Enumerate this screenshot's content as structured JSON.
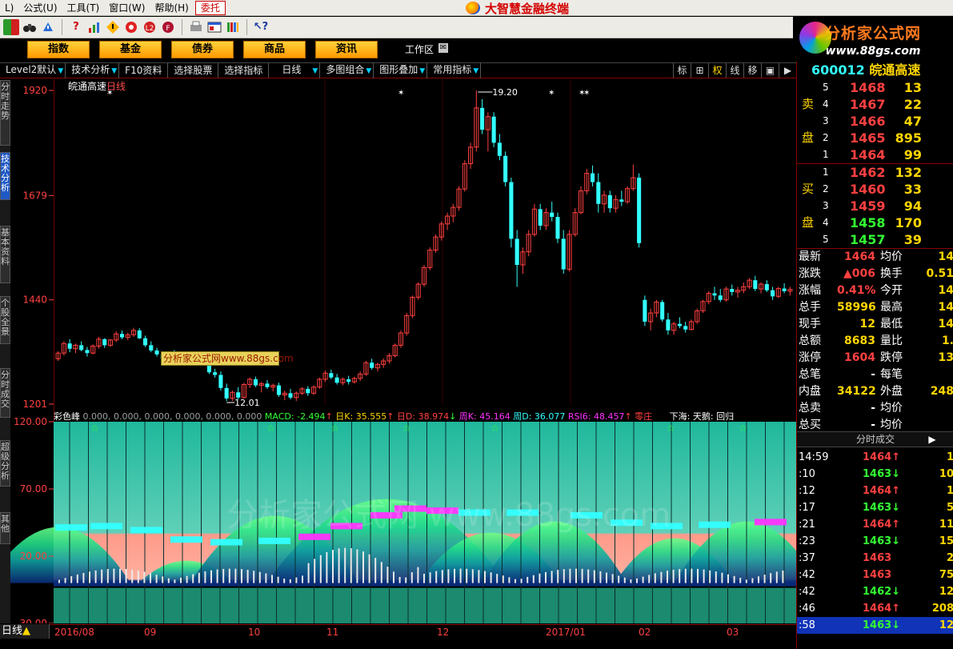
{
  "menu": {
    "items": [
      "L)",
      "公式(U)",
      "工具(T)",
      "窗口(W)",
      "帮助(H)"
    ],
    "hot_button": "委托",
    "app_title": "大智慧金融终端"
  },
  "brand": {
    "name": "分析家公式网",
    "url": "www.88gs.com"
  },
  "nav": {
    "buttons": [
      "指数",
      "基金",
      "债券",
      "商品",
      "资讯"
    ],
    "workspace": "工作区"
  },
  "side_tabs": [
    "分时走势",
    "技术分析",
    "基本资料",
    "个股全景",
    "分时成交",
    "超级分析",
    "其他"
  ],
  "tabs": {
    "items": [
      "Level2默认",
      "技术分析",
      "F10资料",
      "选择股票",
      "选择指标",
      "日线",
      "多图组合",
      "图形叠加",
      "常用指标"
    ],
    "right_buttons": [
      "标",
      "⊞",
      "权",
      "线",
      "移",
      "▣",
      "▶"
    ]
  },
  "chart": {
    "stock_name": "皖通高速",
    "period_label": "日线",
    "price_ticks": [
      "1920",
      "1679",
      "1440",
      "1201"
    ],
    "peak_label": "19.20",
    "trough_label": "12.01",
    "watermark_tag": "分析家公式网www.88gs.com",
    "watermark_big": "分析家公式网 www.88gs.com",
    "osc_ticks": [
      "120.00",
      "70.00",
      "20.00",
      "-30.00"
    ],
    "indicator_name": "彩色峰",
    "indicator_values": "0.000, 0.000, 0.000, 0.000, 0.000, 0.000",
    "macd": "MACD: -2.494",
    "dayk": "日K: 35.555",
    "dayd": "日D: 38.974",
    "weekk": "周K: 45.164",
    "weekd": "周D: 36.077",
    "rsi": "RSI6: 48.457",
    "extra1": "零庄",
    "extra2": "下海: 天鹅:",
    "extra3": "回归",
    "candles": [
      [
        1305,
        1322,
        1300,
        1318
      ],
      [
        1318,
        1345,
        1312,
        1340
      ],
      [
        1340,
        1350,
        1320,
        1328
      ],
      [
        1328,
        1340,
        1318,
        1336
      ],
      [
        1336,
        1345,
        1322,
        1325
      ],
      [
        1325,
        1332,
        1310,
        1318
      ],
      [
        1318,
        1338,
        1315,
        1334
      ],
      [
        1334,
        1355,
        1328,
        1350
      ],
      [
        1350,
        1352,
        1330,
        1336
      ],
      [
        1336,
        1350,
        1332,
        1348
      ],
      [
        1348,
        1368,
        1343,
        1362
      ],
      [
        1362,
        1370,
        1350,
        1354
      ],
      [
        1354,
        1365,
        1348,
        1360
      ],
      [
        1360,
        1376,
        1355,
        1370
      ],
      [
        1370,
        1375,
        1350,
        1352
      ],
      [
        1352,
        1358,
        1332,
        1336
      ],
      [
        1336,
        1345,
        1320,
        1324
      ],
      [
        1324,
        1330,
        1310,
        1315
      ],
      [
        1315,
        1322,
        1302,
        1305
      ],
      [
        1305,
        1320,
        1300,
        1316
      ],
      [
        1316,
        1325,
        1305,
        1308
      ],
      [
        1308,
        1318,
        1300,
        1312
      ],
      [
        1312,
        1318,
        1295,
        1298
      ],
      [
        1298,
        1315,
        1292,
        1310
      ],
      [
        1310,
        1322,
        1302,
        1306
      ],
      [
        1306,
        1310,
        1290,
        1294
      ],
      [
        1294,
        1298,
        1270,
        1274
      ],
      [
        1274,
        1282,
        1262,
        1268
      ],
      [
        1268,
        1276,
        1232,
        1238
      ],
      [
        1238,
        1248,
        1208,
        1214
      ],
      [
        1214,
        1232,
        1208,
        1228
      ],
      [
        1228,
        1240,
        1212,
        1216
      ],
      [
        1216,
        1250,
        1214,
        1246
      ],
      [
        1246,
        1262,
        1238,
        1258
      ],
      [
        1258,
        1264,
        1240,
        1244
      ],
      [
        1244,
        1252,
        1228,
        1248
      ],
      [
        1248,
        1256,
        1236,
        1240
      ],
      [
        1240,
        1248,
        1230,
        1244
      ],
      [
        1244,
        1250,
        1218,
        1222
      ],
      [
        1222,
        1232,
        1210,
        1226
      ],
      [
        1226,
        1236,
        1212,
        1216
      ],
      [
        1216,
        1230,
        1208,
        1226
      ],
      [
        1226,
        1240,
        1222,
        1236
      ],
      [
        1236,
        1242,
        1220,
        1226
      ],
      [
        1226,
        1244,
        1222,
        1240
      ],
      [
        1240,
        1262,
        1236,
        1258
      ],
      [
        1258,
        1278,
        1252,
        1272
      ],
      [
        1272,
        1280,
        1258,
        1262
      ],
      [
        1262,
        1270,
        1246,
        1250
      ],
      [
        1250,
        1262,
        1244,
        1258
      ],
      [
        1258,
        1266,
        1246,
        1252
      ],
      [
        1252,
        1264,
        1248,
        1260
      ],
      [
        1260,
        1276,
        1254,
        1270
      ],
      [
        1270,
        1300,
        1266,
        1296
      ],
      [
        1296,
        1305,
        1280,
        1284
      ],
      [
        1284,
        1296,
        1276,
        1292
      ],
      [
        1292,
        1306,
        1284,
        1300
      ],
      [
        1300,
        1318,
        1294,
        1312
      ],
      [
        1312,
        1340,
        1308,
        1336
      ],
      [
        1336,
        1370,
        1330,
        1364
      ],
      [
        1364,
        1410,
        1358,
        1404
      ],
      [
        1404,
        1450,
        1398,
        1446
      ],
      [
        1446,
        1480,
        1440,
        1476
      ],
      [
        1476,
        1520,
        1470,
        1514
      ],
      [
        1514,
        1560,
        1508,
        1554
      ],
      [
        1554,
        1590,
        1548,
        1584
      ],
      [
        1584,
        1620,
        1576,
        1614
      ],
      [
        1614,
        1640,
        1600,
        1632
      ],
      [
        1632,
        1660,
        1618,
        1652
      ],
      [
        1652,
        1700,
        1644,
        1694
      ],
      [
        1694,
        1760,
        1688,
        1752
      ],
      [
        1752,
        1800,
        1740,
        1790
      ],
      [
        1790,
        1920,
        1780,
        1880
      ],
      [
        1880,
        1900,
        1820,
        1830
      ],
      [
        1830,
        1870,
        1780,
        1860
      ],
      [
        1860,
        1870,
        1790,
        1800
      ],
      [
        1800,
        1820,
        1760,
        1770
      ],
      [
        1770,
        1780,
        1700,
        1710
      ],
      [
        1710,
        1720,
        1560,
        1580
      ],
      [
        1580,
        1600,
        1470,
        1520
      ],
      [
        1520,
        1560,
        1500,
        1550
      ],
      [
        1550,
        1600,
        1540,
        1590
      ],
      [
        1590,
        1660,
        1585,
        1648
      ],
      [
        1648,
        1660,
        1600,
        1610
      ],
      [
        1610,
        1650,
        1600,
        1640
      ],
      [
        1640,
        1665,
        1620,
        1630
      ],
      [
        1630,
        1640,
        1570,
        1580
      ],
      [
        1580,
        1600,
        1500,
        1510
      ],
      [
        1510,
        1600,
        1505,
        1590
      ],
      [
        1590,
        1650,
        1585,
        1640
      ],
      [
        1640,
        1700,
        1636,
        1690
      ],
      [
        1690,
        1740,
        1682,
        1730
      ],
      [
        1730,
        1748,
        1700,
        1710
      ],
      [
        1710,
        1730,
        1640,
        1660
      ],
      [
        1660,
        1690,
        1640,
        1680
      ],
      [
        1680,
        1690,
        1640,
        1650
      ],
      [
        1650,
        1680,
        1640,
        1670
      ],
      [
        1670,
        1690,
        1655,
        1665
      ],
      [
        1665,
        1700,
        1660,
        1695
      ],
      [
        1695,
        1750,
        1690,
        1720
      ],
      [
        1720,
        1730,
        1560,
        1570
      ],
      [
        1440,
        1450,
        1380,
        1390
      ],
      [
        1390,
        1420,
        1370,
        1410
      ],
      [
        1410,
        1440,
        1400,
        1435
      ],
      [
        1435,
        1440,
        1390,
        1395
      ],
      [
        1395,
        1410,
        1360,
        1370
      ],
      [
        1370,
        1390,
        1360,
        1385
      ],
      [
        1385,
        1400,
        1375,
        1380
      ],
      [
        1380,
        1390,
        1365,
        1372
      ],
      [
        1372,
        1395,
        1370,
        1390
      ],
      [
        1390,
        1420,
        1385,
        1415
      ],
      [
        1415,
        1440,
        1410,
        1436
      ],
      [
        1436,
        1460,
        1430,
        1455
      ],
      [
        1455,
        1470,
        1440,
        1450
      ],
      [
        1450,
        1465,
        1435,
        1440
      ],
      [
        1440,
        1470,
        1436,
        1465
      ],
      [
        1465,
        1475,
        1450,
        1458
      ],
      [
        1458,
        1470,
        1445,
        1462
      ],
      [
        1462,
        1480,
        1455,
        1470
      ],
      [
        1470,
        1490,
        1465,
        1485
      ],
      [
        1485,
        1495,
        1460,
        1465
      ],
      [
        1465,
        1480,
        1455,
        1476
      ],
      [
        1476,
        1485,
        1458,
        1462
      ],
      [
        1462,
        1470,
        1440,
        1448
      ],
      [
        1448,
        1470,
        1444,
        1466
      ],
      [
        1466,
        1478,
        1455,
        1460
      ],
      [
        1460,
        1470,
        1450,
        1464
      ]
    ],
    "x_dates": [
      "2016/08",
      "09",
      "10",
      "11",
      "12",
      "2017/01",
      "02",
      "03"
    ],
    "bottom_label": "日线"
  },
  "quote": {
    "code": "600012",
    "name": "皖通高速",
    "sell_label": [
      "卖",
      "盘"
    ],
    "buy_label": [
      "买",
      "盘"
    ],
    "asks": [
      {
        "lv": "5",
        "px": "1468",
        "vol": "13"
      },
      {
        "lv": "4",
        "px": "1467",
        "vol": "22"
      },
      {
        "lv": "3",
        "px": "1466",
        "vol": "47"
      },
      {
        "lv": "2",
        "px": "1465",
        "vol": "895"
      },
      {
        "lv": "1",
        "px": "1464",
        "vol": "99"
      }
    ],
    "bids": [
      {
        "lv": "1",
        "px": "1462",
        "vol": "132"
      },
      {
        "lv": "2",
        "px": "1460",
        "vol": "33"
      },
      {
        "lv": "3",
        "px": "1459",
        "vol": "94"
      },
      {
        "lv": "4",
        "px": "1458",
        "vol": "170"
      },
      {
        "lv": "5",
        "px": "1457",
        "vol": "39"
      }
    ],
    "stats": [
      {
        "k1": "最新",
        "v1": "1464",
        "c1": "red",
        "k2": "均价",
        "v2": "14"
      },
      {
        "k1": "涨跌",
        "v1": "▲006",
        "c1": "red",
        "k2": "换手",
        "v2": "0.51"
      },
      {
        "k1": "涨幅",
        "v1": "0.41%",
        "c1": "red",
        "k2": "今开",
        "v2": "14"
      },
      {
        "k1": "总手",
        "v1": "58996",
        "c1": "yel",
        "k2": "最高",
        "v2": "14"
      },
      {
        "k1": "现手",
        "v1": "12",
        "c1": "yel",
        "k2": "最低",
        "v2": "14"
      },
      {
        "k1": "总额",
        "v1": "8683",
        "c1": "yel",
        "k2": "量比",
        "v2": "1."
      },
      {
        "k1": "涨停",
        "v1": "1604",
        "c1": "red",
        "k2": "跌停",
        "v2": "13"
      },
      {
        "k1": "总笔",
        "v1": "-",
        "c1": "wht",
        "k2": "每笔",
        "v2": ""
      },
      {
        "k1": "内盘",
        "v1": "34122",
        "c1": "yel",
        "k2": "外盘",
        "v2": "248"
      },
      {
        "k1": "总卖",
        "v1": "-",
        "c1": "wht",
        "k2": "均价",
        "v2": ""
      },
      {
        "k1": "总买",
        "v1": "-",
        "c1": "wht",
        "k2": "均价",
        "v2": ""
      }
    ],
    "ticks_header": "分时成交",
    "ticks": [
      {
        "t": "14:59",
        "p": "1464",
        "d": "up",
        "v": "1"
      },
      {
        "t": ":10",
        "p": "1463",
        "d": "dn",
        "v": "10"
      },
      {
        "t": ":12",
        "p": "1464",
        "d": "up",
        "v": "1"
      },
      {
        "t": ":17",
        "p": "1463",
        "d": "dn",
        "v": "5"
      },
      {
        "t": ":21",
        "p": "1464",
        "d": "up",
        "v": "11"
      },
      {
        "t": ":23",
        "p": "1463",
        "d": "dn",
        "v": "15"
      },
      {
        "t": ":37",
        "p": "1463",
        "d": "",
        "v": "2"
      },
      {
        "t": ":42",
        "p": "1463",
        "d": "",
        "v": "75"
      },
      {
        "t": ":42",
        "p": "1462",
        "d": "dn",
        "v": "12"
      },
      {
        "t": ":46",
        "p": "1464",
        "d": "up",
        "v": "208"
      },
      {
        "t": ":58",
        "p": "1463",
        "d": "dn",
        "v": "12"
      }
    ]
  },
  "colors": {
    "up": "#ff4040",
    "down": "#33ffff",
    "accent": "#ffd600",
    "bg": "#000000"
  }
}
